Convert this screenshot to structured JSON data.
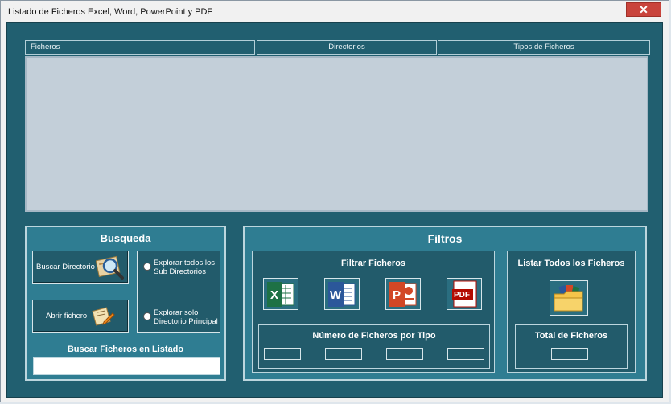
{
  "window": {
    "title": "Listado de Ficheros Excel, Word, PowerPoint y PDF",
    "close_glyph": "✕"
  },
  "list": {
    "columns": [
      "Ficheros",
      "Directorios",
      "Tipos de Ficheros"
    ],
    "rows": []
  },
  "busqueda": {
    "title": "Busqueda",
    "buscar_directorio": "Buscar Directorio",
    "abrir_fichero": "Abrir fichero",
    "radio_subdirs": "Explorar todos los Sub Directorios",
    "radio_principal": "Explorar solo Directorio Principal",
    "buscar_label": "Buscar Ficheros en Listado",
    "buscar_value": ""
  },
  "filtros": {
    "title": "Filtros",
    "filtrar_title": "Filtrar Ficheros",
    "file_types": [
      "excel",
      "word",
      "powerpoint",
      "pdf"
    ],
    "numero_title": "Número de Ficheros por Tipo",
    "counts": [
      "",
      "",
      "",
      ""
    ],
    "listar_title": "Listar Todos los Ficheros",
    "total_title": "Total de Ficheros",
    "total_value": ""
  },
  "colors": {
    "panel": "#2f7d92",
    "background": "#215f70",
    "list": "#c3cfd9",
    "excel": "#1e7145",
    "word": "#2b579a",
    "powerpoint": "#d24726",
    "pdf": "#b30b00"
  }
}
